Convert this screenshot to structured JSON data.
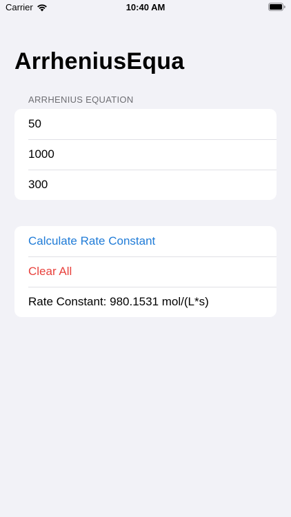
{
  "status_bar": {
    "carrier": "Carrier",
    "time": "10:40 AM",
    "icons": [
      "wifi-icon",
      "battery-icon"
    ]
  },
  "nav": {
    "title": "ArrheniusEqua"
  },
  "form": {
    "section_header": "ARRHENIUS EQUATION",
    "fields": [
      {
        "value": "50"
      },
      {
        "value": "1000"
      },
      {
        "value": "300"
      }
    ]
  },
  "actions": {
    "calculate_label": "Calculate Rate Constant",
    "clear_label": "Clear All",
    "result_text": "Rate Constant: 980.1531 mol/(L*s)"
  },
  "colors": {
    "background": "#f2f2f7",
    "link_blue": "#1f7bd7",
    "destructive_red": "#e8413c",
    "section_header_gray": "#6d6d72"
  }
}
